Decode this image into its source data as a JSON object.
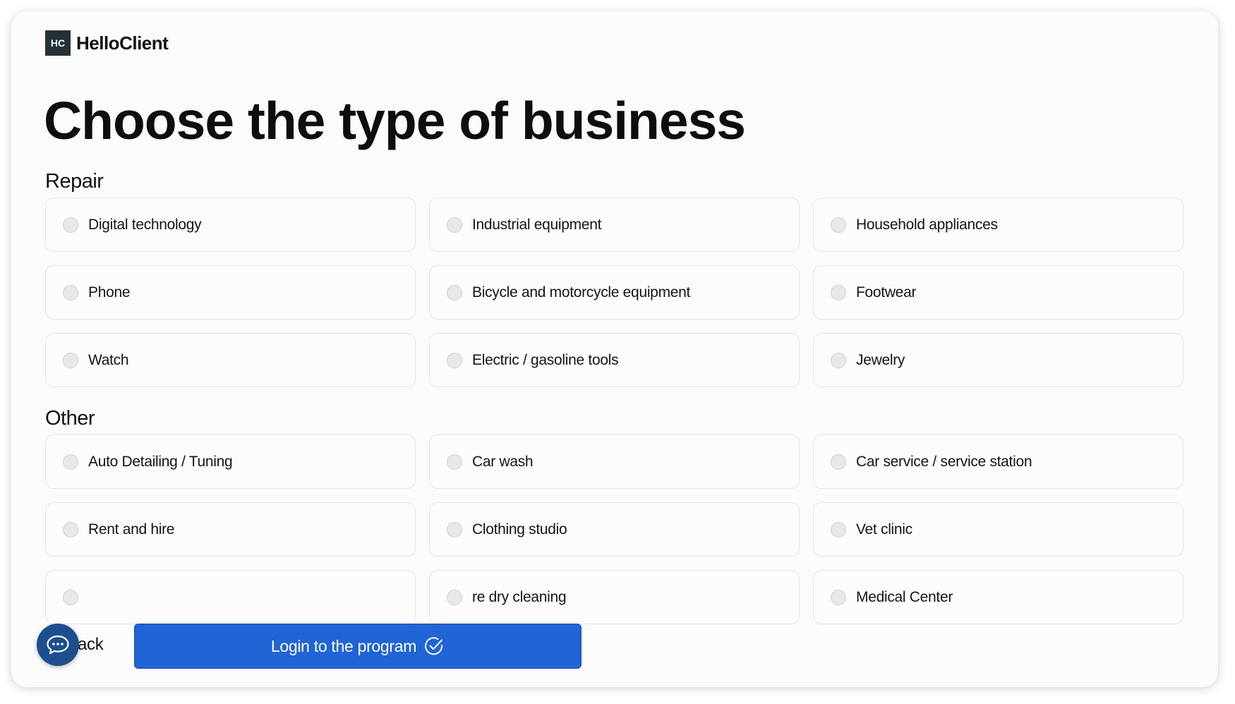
{
  "brand": {
    "mark": "HC",
    "name": "HelloClient"
  },
  "page_title": "Choose the type of business",
  "sections": [
    {
      "title": "Repair",
      "options": [
        "Digital technology",
        "Industrial equipment",
        "Household appliances",
        "Phone",
        "Bicycle and motorcycle equipment",
        "Footwear",
        "Watch",
        "Electric / gasoline tools",
        "Jewelry"
      ]
    },
    {
      "title": "Other",
      "options": [
        "Auto Detailing / Tuning",
        "Car wash",
        "Car service / service station",
        "Rent and hire",
        "Clothing studio",
        "Vet clinic",
        "",
        "re dry cleaning",
        "Medical Center"
      ]
    }
  ],
  "footer": {
    "back_label": "ack",
    "login_label": "Login to the program",
    "chat_icon": "chat-bubble-icon",
    "check_icon": "check-circle-icon"
  },
  "colors": {
    "primary": "#2064d5",
    "chat": "#1d4e8e",
    "logo_bg": "#243238"
  }
}
